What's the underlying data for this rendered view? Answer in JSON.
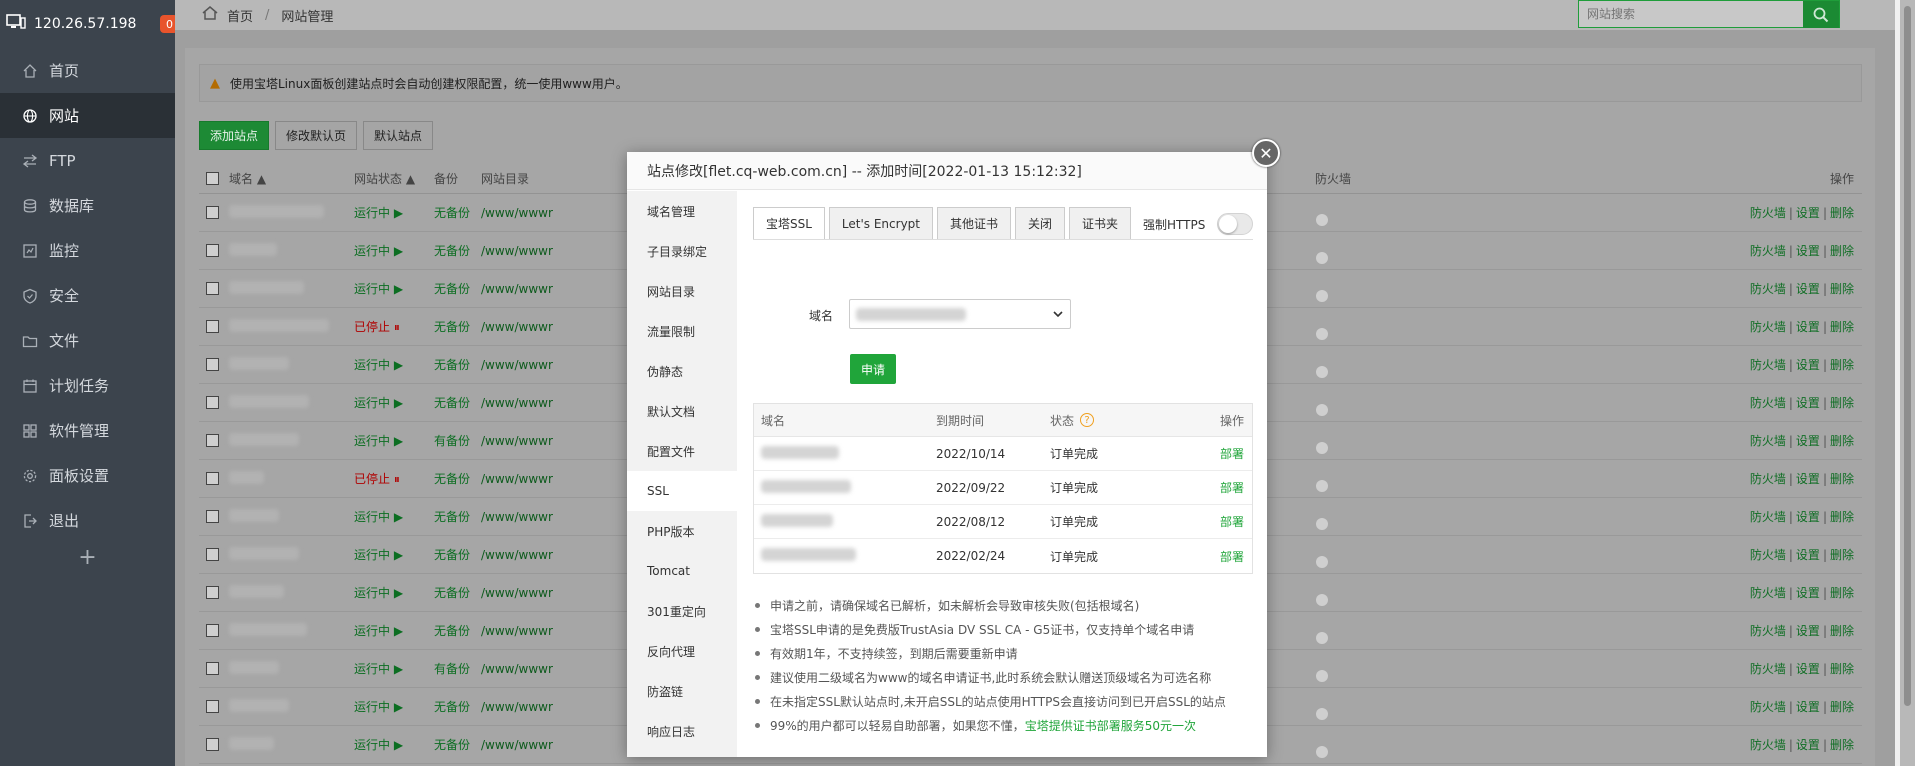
{
  "sidebar": {
    "ip": "120.26.57.198",
    "badge": "0",
    "items": [
      {
        "label": "首页",
        "icon": "home-icon",
        "active": false
      },
      {
        "label": "网站",
        "icon": "globe-icon",
        "active": true
      },
      {
        "label": "FTP",
        "icon": "ftp-icon",
        "active": false
      },
      {
        "label": "数据库",
        "icon": "database-icon",
        "active": false
      },
      {
        "label": "监控",
        "icon": "monitor-icon",
        "active": false
      },
      {
        "label": "安全",
        "icon": "shield-icon",
        "active": false
      },
      {
        "label": "文件",
        "icon": "folder-icon",
        "active": false
      },
      {
        "label": "计划任务",
        "icon": "calendar-icon",
        "active": false
      },
      {
        "label": "软件管理",
        "icon": "grid-icon",
        "active": false
      },
      {
        "label": "面板设置",
        "icon": "gear-icon",
        "active": false
      },
      {
        "label": "退出",
        "icon": "logout-icon",
        "active": false
      }
    ],
    "plus": "+"
  },
  "topbar": {
    "breadcrumb_home": "首页",
    "breadcrumb_sep": "/",
    "breadcrumb_current": "网站管理",
    "search_placeholder": "网站搜索"
  },
  "notice": "使用宝塔Linux面板创建站点时会自动创建权限配置，统一使用www用户。",
  "actions": {
    "add": "添加站点",
    "edit_default": "修改默认页",
    "default_site": "默认站点"
  },
  "site_table": {
    "headers": {
      "domain": "域名 ▲",
      "status": "网站状态 ▲",
      "backup": "备份",
      "dir": "网站目录",
      "firewall": "防火墙",
      "ops": "操作"
    },
    "rows": [
      {
        "status": "运行中 ▶",
        "running": true,
        "backup": "无备份",
        "dir": "/www/wwwr"
      },
      {
        "status": "运行中 ▶",
        "running": true,
        "backup": "无备份",
        "dir": "/www/wwwr"
      },
      {
        "status": "运行中 ▶",
        "running": true,
        "backup": "无备份",
        "dir": "/www/wwwr"
      },
      {
        "status": "已停止 ⏸",
        "running": false,
        "backup": "无备份",
        "dir": "/www/wwwr"
      },
      {
        "status": "运行中 ▶",
        "running": true,
        "backup": "无备份",
        "dir": "/www/wwwr"
      },
      {
        "status": "运行中 ▶",
        "running": true,
        "backup": "无备份",
        "dir": "/www/wwwr"
      },
      {
        "status": "运行中 ▶",
        "running": true,
        "backup": "有备份",
        "dir": "/www/wwwr"
      },
      {
        "status": "已停止 ⏸",
        "running": false,
        "backup": "无备份",
        "dir": "/www/wwwr"
      },
      {
        "status": "运行中 ▶",
        "running": true,
        "backup": "无备份",
        "dir": "/www/wwwr"
      },
      {
        "status": "运行中 ▶",
        "running": true,
        "backup": "无备份",
        "dir": "/www/wwwr"
      },
      {
        "status": "运行中 ▶",
        "running": true,
        "backup": "无备份",
        "dir": "/www/wwwr"
      },
      {
        "status": "运行中 ▶",
        "running": true,
        "backup": "无备份",
        "dir": "/www/wwwr"
      },
      {
        "status": "运行中 ▶",
        "running": true,
        "backup": "有备份",
        "dir": "/www/wwwr"
      },
      {
        "status": "运行中 ▶",
        "running": true,
        "backup": "无备份",
        "dir": "/www/wwwr"
      },
      {
        "status": "运行中 ▶",
        "running": true,
        "backup": "无备份",
        "dir": "/www/wwwr"
      }
    ],
    "op_firewall": "防火墙",
    "op_settings": "设置",
    "op_delete": "删除",
    "op_sep": "|"
  },
  "modal": {
    "title": "站点修改[flet.cq-web.com.cn] -- 添加时间[2022-01-13 15:12:32]",
    "close": "✕",
    "nav": [
      "域名管理",
      "子目录绑定",
      "网站目录",
      "流量限制",
      "伪静态",
      "默认文档",
      "配置文件",
      "SSL",
      "PHP版本",
      "Tomcat",
      "301重定向",
      "反向代理",
      "防盗链",
      "响应日志"
    ],
    "nav_active": "SSL",
    "tabs": [
      "宝塔SSL",
      "Let's Encrypt",
      "其他证书",
      "关闭",
      "证书夹"
    ],
    "active_tab": "宝塔SSL",
    "force_https": "强制HTTPS",
    "force_https_on": false,
    "domain_label": "域名",
    "apply": "申请",
    "cert_table": {
      "headers": {
        "domain": "域名",
        "expire": "到期时间",
        "status": "状态",
        "status_help": "?",
        "ops": "操作"
      },
      "rows": [
        {
          "expire": "2022/10/14",
          "status": "订单完成",
          "op": "部署"
        },
        {
          "expire": "2022/09/22",
          "status": "订单完成",
          "op": "部署"
        },
        {
          "expire": "2022/08/12",
          "status": "订单完成",
          "op": "部署"
        },
        {
          "expire": "2022/02/24",
          "status": "订单完成",
          "op": "部署"
        }
      ]
    },
    "tips": [
      "申请之前，请确保域名已解析，如未解析会导致审核失败(包括根域名)",
      "宝塔SSL申请的是免费版TrustAsia DV SSL CA - G5证书，仅支持单个域名申请",
      "有效期1年，不支持续签，到期后需要重新申请",
      "建议使用二级域名为www的域名申请证书,此时系统会默认赠送顶级域名为可选名称",
      "在未指定SSL默认站点时,未开启SSL的站点使用HTTPS会直接访问到已开启SSL的站点"
    ],
    "last_tip_prefix": "99%的用户都可以轻易自助部署，如果您不懂，",
    "last_tip_link": "宝塔提供证书部署服务50元一次"
  },
  "colors": {
    "accent_green": "#20a53a",
    "sidebar_bg": "#3c444d",
    "badge": "#e8542c",
    "stopped_red": "#b00000"
  }
}
